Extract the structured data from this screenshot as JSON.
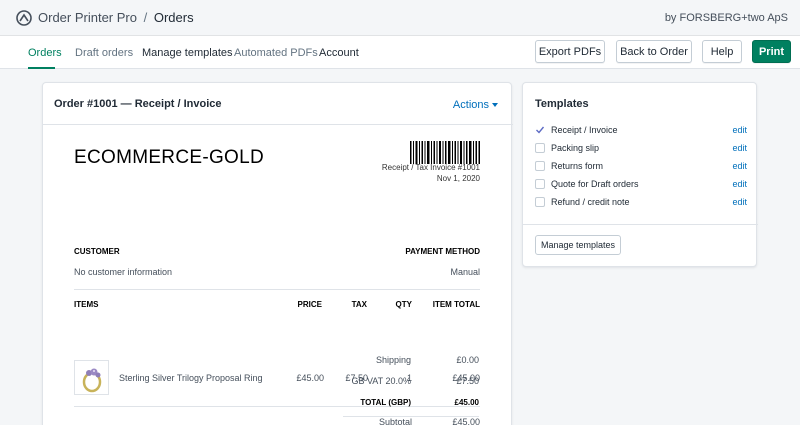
{
  "app": {
    "name": "Order Printer Pro",
    "separator": "/",
    "page": "Orders",
    "byline": "by FORSBERG+two ApS"
  },
  "nav": {
    "tabs": [
      {
        "label": "Orders",
        "state": "active"
      },
      {
        "label": "Draft orders",
        "state": "muted"
      },
      {
        "label": "Manage templates",
        "state": "normal"
      },
      {
        "label": "Automated PDFs",
        "state": "muted"
      },
      {
        "label": "Account",
        "state": "normal"
      }
    ],
    "buttons": {
      "export": "Export PDFs",
      "back": "Back to Order",
      "help": "Help",
      "print": "Print"
    }
  },
  "order_card": {
    "title": "Order #1001 — Receipt / Invoice",
    "actions": "Actions",
    "document": {
      "shop_name": "ECOMMERCE-GOLD",
      "invoice_label": "Receipt / Tax Invoice #1001",
      "date": "Nov 1, 2020",
      "customer_label": "CUSTOMER",
      "customer_value": "No customer information",
      "payment_label": "PAYMENT METHOD",
      "payment_value": "Manual",
      "columns": {
        "items": "ITEMS",
        "price": "PRICE",
        "tax": "TAX",
        "qty": "QTY",
        "total": "ITEM TOTAL"
      },
      "line_item": {
        "name": "Sterling Silver Trilogy Proposal Ring",
        "price": "£45.00",
        "tax": "£7.50",
        "qty": "1",
        "total": "£45.00"
      },
      "summary": {
        "subtotal_label": "Subtotal",
        "subtotal": "£45.00",
        "shipping_label": "Shipping",
        "shipping": "£0.00",
        "vat_label": "GB VAT 20.0%",
        "vat": "£7.50",
        "total_label": "TOTAL (GBP)",
        "total": "£45.00"
      }
    }
  },
  "templates_card": {
    "title": "Templates",
    "items": [
      {
        "label": "Receipt / Invoice",
        "checked": true,
        "edit": "edit"
      },
      {
        "label": "Packing slip",
        "checked": false,
        "edit": "edit"
      },
      {
        "label": "Returns form",
        "checked": false,
        "edit": "edit"
      },
      {
        "label": "Quote for Draft orders",
        "checked": false,
        "edit": "edit"
      },
      {
        "label": "Refund / credit note",
        "checked": false,
        "edit": "edit"
      }
    ],
    "manage_button": "Manage templates"
  },
  "colors": {
    "accent": "#008060",
    "link": "#006fbb",
    "background": "#f4f6f8"
  }
}
